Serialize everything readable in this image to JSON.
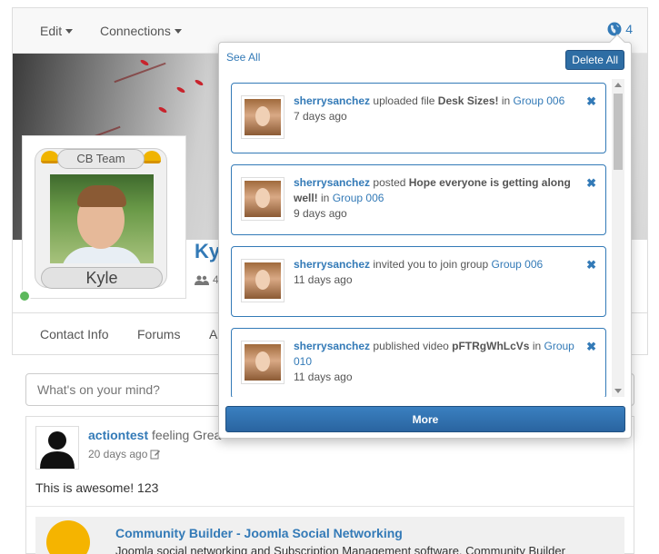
{
  "navbar": {
    "edit_label": "Edit",
    "connections_label": "Connections",
    "notification_count": "4"
  },
  "profile": {
    "team_label": "CB Team",
    "avatar_name": "Kyle",
    "name": "Kyle",
    "connections_count": "4",
    "online_color": "#5cb85c"
  },
  "tabs": [
    {
      "label": "Contact Info"
    },
    {
      "label": "Forums"
    },
    {
      "label": "Ar"
    }
  ],
  "stream": {
    "status_placeholder": "What's on your mind?",
    "post": {
      "author": "actiontest",
      "feeling": "feeling Grea",
      "time": "20 days ago",
      "body": "This is awesome! 123",
      "embed_title": "Community Builder - Joomla Social Networking",
      "embed_desc": "Joomla social networking and Subscription Management software. Community Builder"
    }
  },
  "notifications": {
    "see_all_label": "See All",
    "delete_all_label": "Delete All",
    "more_label": "More",
    "accent": "#337ab7",
    "items": [
      {
        "user": "sherrysanchez",
        "pre": "uploaded file",
        "strong": "Desk Sizes!",
        "post": "in",
        "link": "Group 006",
        "time": "7 days ago"
      },
      {
        "user": "sherrysanchez",
        "pre": "posted",
        "strong": "Hope everyone is getting along well!",
        "post": "in",
        "link": "Group 006",
        "time": "9 days ago"
      },
      {
        "user": "sherrysanchez",
        "pre": "invited you to join group",
        "strong": "",
        "post": "",
        "link": "Group 006",
        "time": "11 days ago"
      },
      {
        "user": "sherrysanchez",
        "pre": "published video",
        "strong": "pFTRgWhLcVs",
        "post": "in",
        "link": "Group 010",
        "time": "11 days ago"
      }
    ]
  }
}
